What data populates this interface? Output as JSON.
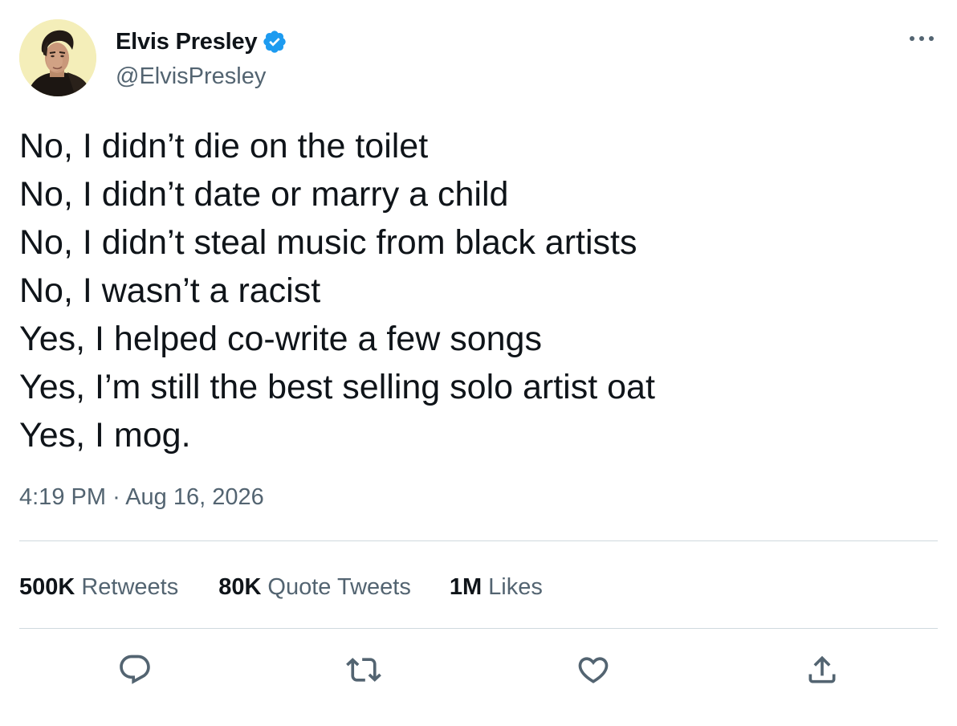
{
  "author": {
    "display_name": "Elvis Presley",
    "handle": "@ElvisPresley",
    "verified": true,
    "verified_color": "#1d9bf0",
    "avatar_icon": "profile-photo"
  },
  "tweet": {
    "lines": [
      "No, I didn’t die on the toilet",
      "No, I didn’t date or marry a child",
      "No, I didn’t steal music from black artists",
      "No, I wasn’t a racist",
      "Yes, I helped co-write a few songs",
      "Yes, I’m still the best selling solo artist oat",
      "Yes, I mog."
    ],
    "time": "4:19 PM",
    "separator": "·",
    "date": "Aug 16, 2026"
  },
  "stats": {
    "retweets": {
      "count": "500K",
      "label": "Retweets"
    },
    "quote_tweets": {
      "count": "80K",
      "label": "Quote Tweets"
    },
    "likes": {
      "count": "1M",
      "label": "Likes"
    }
  },
  "actions": {
    "reply_icon": "reply-icon",
    "retweet_icon": "retweet-icon",
    "like_icon": "heart-icon",
    "share_icon": "share-icon"
  },
  "colors": {
    "text_primary": "#0f1419",
    "text_secondary": "#536471",
    "divider": "#cfd9de",
    "icon": "#536471"
  }
}
